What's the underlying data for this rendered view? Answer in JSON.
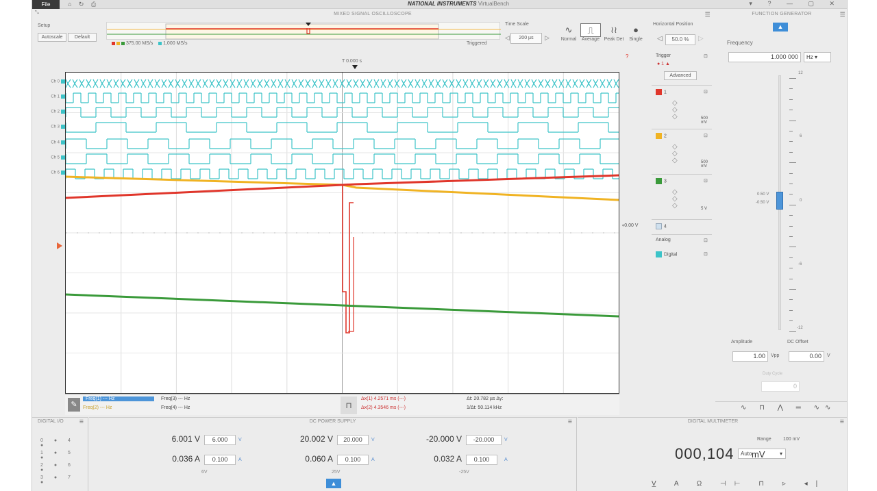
{
  "titlebar": {
    "file_tab": "File",
    "icons": "⌂ ↻ ⎙",
    "brand": "NATIONAL INSTRUMENTS",
    "app_name": "VirtualBench",
    "controls": "▾ ?  —  ▢  ✕"
  },
  "scope": {
    "header": "MIXED SIGNAL OSCILLOSCOPE",
    "setup_label": "Setup",
    "btn_autoscale": "Autoscale",
    "btn_default": "Default",
    "overview_legend_left": "375.00 MS/s",
    "overview_legend_right": "1,000 MS/s",
    "overview_status": "Triggered",
    "zoom_label": "Time Scale",
    "zoom_value": "200 µs",
    "modes": [
      {
        "label": "Normal",
        "glyph": "∿"
      },
      {
        "label": "Average",
        "glyph": "⎍"
      },
      {
        "label": "Peak Det",
        "glyph": "≀≀"
      },
      {
        "label": "Single",
        "glyph": "●"
      }
    ],
    "hpos_label": "Horizontal Position",
    "hpos_value": "50.0 %",
    "trigger_marker": "T  0.000 s",
    "trigger_level": "0.00 V",
    "channel_labels": [
      "Ch 0",
      "Ch 1",
      "Ch 2",
      "Ch 3",
      "Ch 4",
      "Ch 5",
      "Ch 6"
    ],
    "readouts": {
      "r1": "Freq(1)   ---   Hz",
      "r2": "Freq(2)   ---   Hz",
      "r3": "Freq(3)   ---   Hz",
      "r4": "Freq(4)   ---   Hz",
      "c1": "Δx(1)    4.2571 ms   (---)",
      "c2": "Δx(2)    4.3546 ms   (---)",
      "c3": "Δt:  20.782 µs       Δy:",
      "c4": "1/Δt:  50.114 kHz"
    }
  },
  "sidebar": {
    "trigger_title": "Trigger",
    "trigger_sub": "● 1 ▲",
    "trigger_btn": "Advanced",
    "ch1": "1",
    "ch2": "2",
    "ch3": "3",
    "ch4": "4",
    "ch1_scale": "500 mV",
    "ch2_scale": "500 mV",
    "ch3_scale": "5 V",
    "analog_title": "Analog",
    "digital_label": "Digital",
    "colors": {
      "ch1": "#e0362b",
      "ch2": "#f0b323",
      "ch3": "#3a9a3a",
      "ch4": "#cfe0ee",
      "digital": "#3cc3c8"
    }
  },
  "generator": {
    "header": "FUNCTION GENERATOR",
    "tab_glyph": "▲",
    "freq_label": "Frequency",
    "freq_value": "1.000 000",
    "freq_unit": "Hz",
    "scale_top": "12",
    "scale_6": "6",
    "scale_0": "0",
    "scale_m6": "-6",
    "scale_bottom": "-12",
    "marker_hi": "0.50 V",
    "marker_lo": "-0.50 V",
    "amplitude_label": "Amplitude",
    "amplitude_value": "1.00",
    "amplitude_unit": "Vpp",
    "offset_label": "DC Offset",
    "offset_value": "0.00",
    "offset_unit": "V",
    "dutycycle_label": "Duty Cycle",
    "dutycycle_value": "0",
    "wave_buttons": "∿ ⊓ ⋀ ═ ∿∿"
  },
  "dio": {
    "header": "DIGITAL I/O",
    "rows": [
      "0  ●  4  ●",
      "1  ●  5  ●",
      "2  ●  6  ●",
      "3  ●  7  ●"
    ]
  },
  "power": {
    "header": "DC POWER SUPPLY",
    "tab_glyph": "▲",
    "ch_labels": [
      "6V",
      "25V",
      "-25V"
    ],
    "ch": [
      {
        "v_meas": "6.001 V",
        "v_set": "6.000",
        "v_unit": "V",
        "a_meas": "0.036 A",
        "a_set": "0.100",
        "a_unit": "A"
      },
      {
        "v_meas": "20.002 V",
        "v_set": "20.000",
        "v_unit": "V",
        "a_meas": "0.060 A",
        "a_set": "0.100",
        "a_unit": "A"
      },
      {
        "v_meas": "-20.000 V",
        "v_set": "-20.000",
        "v_unit": "V",
        "a_meas": "0.032 A",
        "a_set": "0.100",
        "a_unit": "A"
      }
    ]
  },
  "dmm": {
    "header": "DIGITAL MULTIMETER",
    "range_label": "Range",
    "range_value": "100 mV",
    "mode_value": "Auto",
    "reading": "000,104",
    "unit": "mV",
    "icons": "V̲ A Ω ⊣⊢ ⊓ ▹ ◂|"
  }
}
